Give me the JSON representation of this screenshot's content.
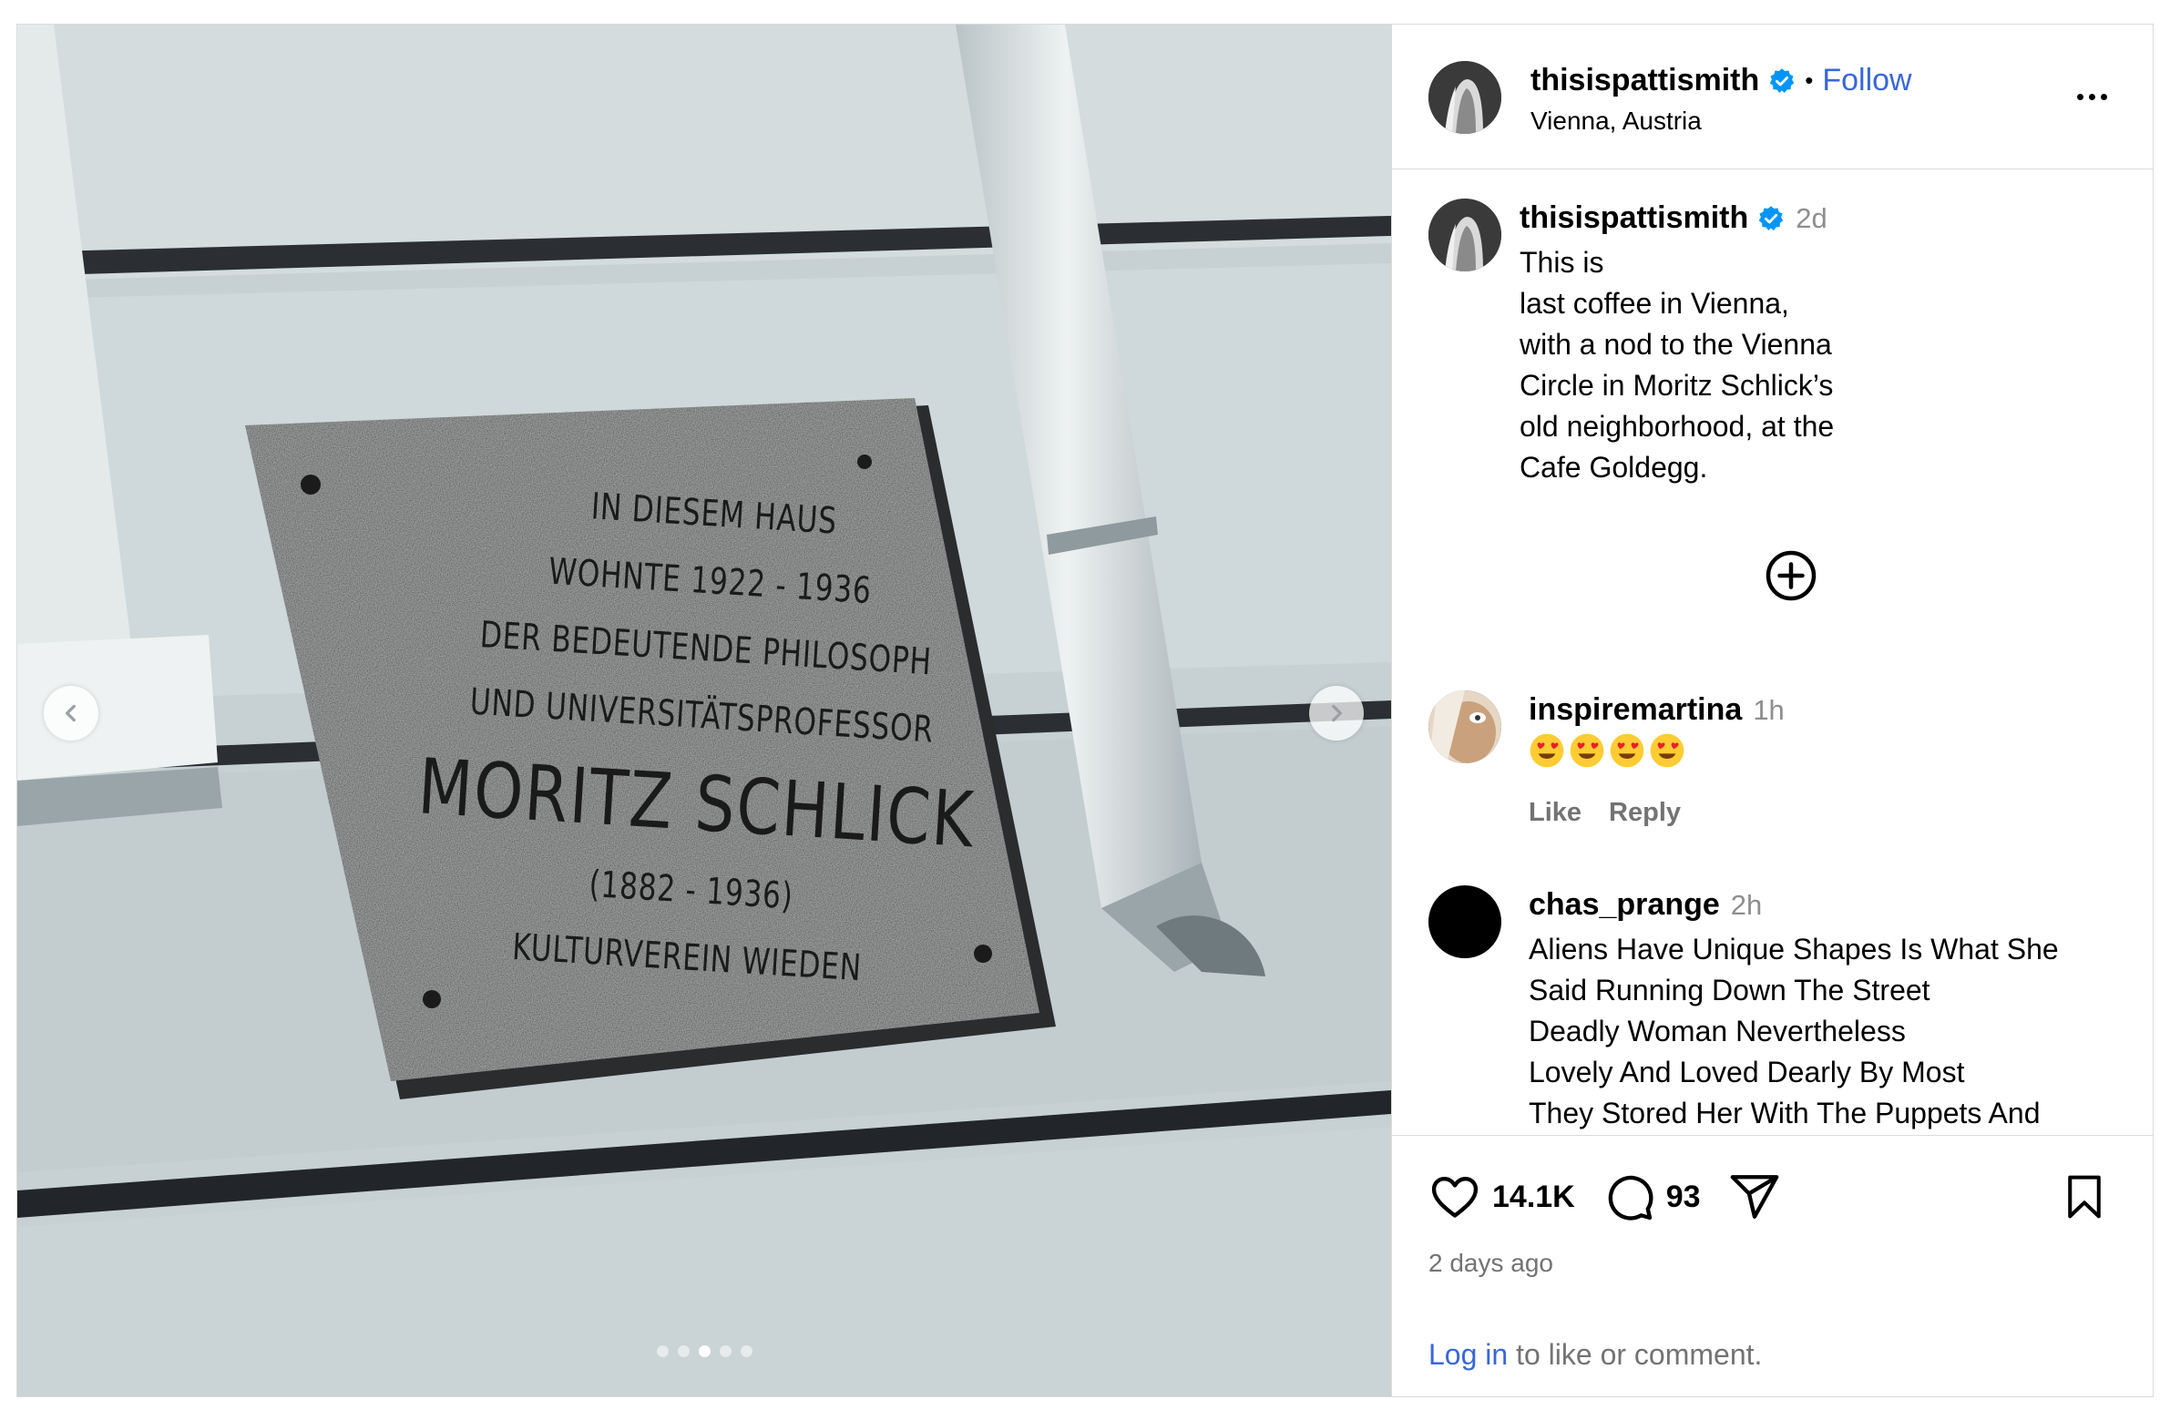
{
  "header": {
    "username": "thisispattismith",
    "separator": "•",
    "follow_label": "Follow",
    "location": "Vienna, Austria",
    "more_icon": "more-options-icon"
  },
  "media": {
    "plaque_lines": [
      "IN DIESEM HAUS",
      "WOHNTE 1922 - 1936",
      "DER BEDEUTENDE PHILOSOPH",
      "UND UNIVERSITÄTSPROFESSOR"
    ],
    "plaque_name": "MORITZ SCHLICK",
    "plaque_dates": "(1882 - 1936)",
    "plaque_footer": "KULTURVEREIN WIEDEN",
    "carousel_total": 5,
    "carousel_active": 3
  },
  "caption": {
    "username": "thisispattismith",
    "time": "2d",
    "text": "This is\nlast coffee in Vienna,\nwith a nod to the Vienna\nCircle in Moritz Schlick’s\nold neighborhood, at the\nCafe Goldegg."
  },
  "comments": [
    {
      "username": "inspiremartina",
      "time": "1h",
      "emoji": "😍😍😍😍",
      "like_label": "Like",
      "reply_label": "Reply"
    },
    {
      "username": "chas_prange",
      "time": "2h",
      "text": "Aliens Have Unique Shapes Is What She\nSaid Running Down The Street\nDeadly Woman Nevertheless\nLovely And Loved Dearly By Most\nThey Stored Her With The Puppets And\nFloats For The World Parade"
    }
  ],
  "actions": {
    "likes": "14.1K",
    "comments": "93",
    "posted": "2 days ago"
  },
  "login": {
    "link": "Log in",
    "rest": " to like or comment."
  },
  "colors": {
    "verified": "#0095f6",
    "follow": "#3a67d8",
    "muted": "#737373"
  }
}
